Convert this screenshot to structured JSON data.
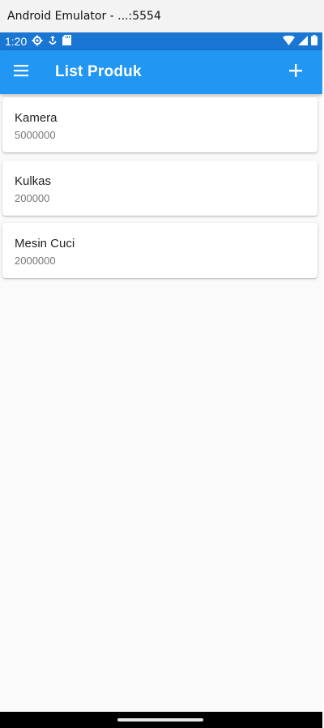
{
  "window": {
    "title": "Android Emulator - ...:5554"
  },
  "status_bar": {
    "time": "1:20",
    "icons": [
      "settings-gear-icon",
      "debug-icon",
      "sd-card-icon",
      "wifi-icon",
      "signal-icon",
      "battery-icon"
    ]
  },
  "app_bar": {
    "title": "List Produk",
    "menu_icon": "menu-icon",
    "add_icon": "add-icon"
  },
  "products": [
    {
      "name": "Kamera",
      "price": "5000000"
    },
    {
      "name": "Kulkas",
      "price": "200000"
    },
    {
      "name": "Mesin Cuci",
      "price": "2000000"
    }
  ],
  "colors": {
    "status_bar": "#1976d2",
    "app_bar": "#2196f3",
    "background": "#fafafa"
  }
}
